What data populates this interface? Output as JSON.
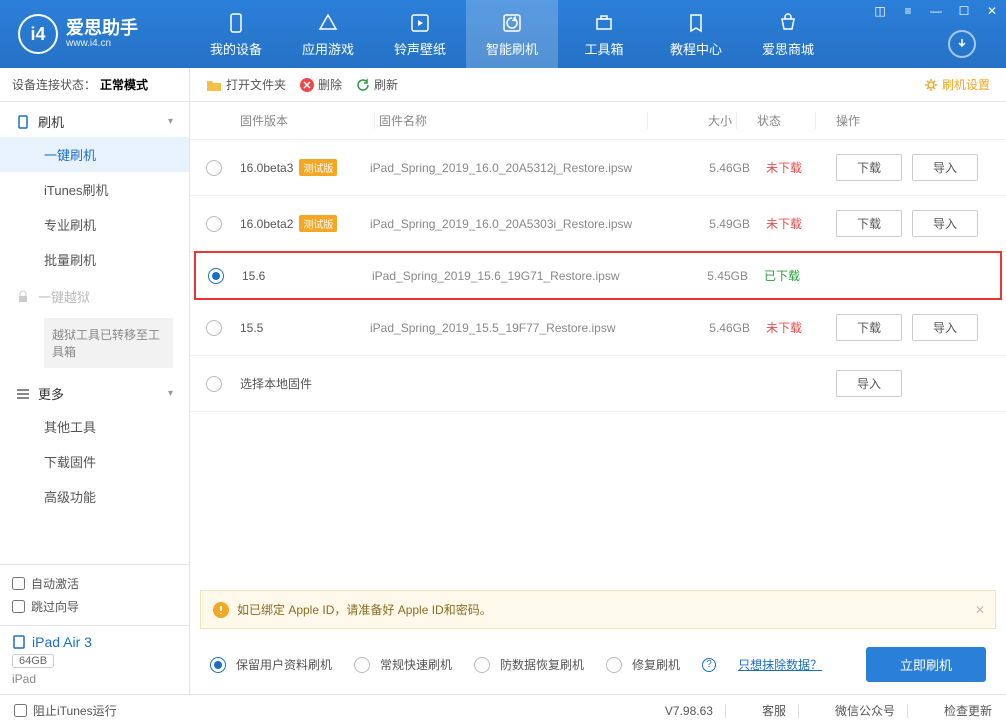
{
  "logo": {
    "title": "爱思助手",
    "sub": "www.i4.cn"
  },
  "nav": [
    "我的设备",
    "应用游戏",
    "铃声壁纸",
    "智能刷机",
    "工具箱",
    "教程中心",
    "爱思商城"
  ],
  "activeNav": 3,
  "status": {
    "label": "设备连接状态：",
    "value": "正常模式"
  },
  "side": {
    "group1": "刷机",
    "items1": [
      "一键刷机",
      "iTunes刷机",
      "专业刷机",
      "批量刷机"
    ],
    "jailbreak": "一键越狱",
    "jbNotice": "越狱工具已转移至工具箱",
    "group2": "更多",
    "items2": [
      "其他工具",
      "下载固件",
      "高级功能"
    ]
  },
  "sideBottom": {
    "autoActivate": "自动激活",
    "skipWizard": "跳过向导"
  },
  "device": {
    "name": "iPad Air 3",
    "capacity": "64GB",
    "type": "iPad"
  },
  "toolbar": {
    "open": "打开文件夹",
    "delete": "删除",
    "refresh": "刷新",
    "settings": "刷机设置"
  },
  "cols": {
    "ver": "固件版本",
    "name": "固件名称",
    "size": "大小",
    "status": "状态",
    "ops": "操作"
  },
  "btns": {
    "download": "下载",
    "import": "导入"
  },
  "statuses": {
    "nd": "未下载",
    "dl": "已下载"
  },
  "badge": "测试版",
  "firmware": [
    {
      "ver": "16.0beta3",
      "beta": true,
      "name": "iPad_Spring_2019_16.0_20A5312j_Restore.ipsw",
      "size": "5.46GB",
      "downloaded": false,
      "selected": false,
      "showOps": true
    },
    {
      "ver": "16.0beta2",
      "beta": true,
      "name": "iPad_Spring_2019_16.0_20A5303i_Restore.ipsw",
      "size": "5.49GB",
      "downloaded": false,
      "selected": false,
      "showOps": true
    },
    {
      "ver": "15.6",
      "beta": false,
      "name": "iPad_Spring_2019_15.6_19G71_Restore.ipsw",
      "size": "5.45GB",
      "downloaded": true,
      "selected": true,
      "showOps": false,
      "highlight": true
    },
    {
      "ver": "15.5",
      "beta": false,
      "name": "iPad_Spring_2019_15.5_19F77_Restore.ipsw",
      "size": "5.46GB",
      "downloaded": false,
      "selected": false,
      "showOps": true
    }
  ],
  "localRow": "选择本地固件",
  "alert": "如已绑定 Apple ID，请准备好 Apple ID和密码。",
  "options": [
    "保留用户资料刷机",
    "常规快速刷机",
    "防数据恢复刷机",
    "修复刷机"
  ],
  "eraseLink": "只想抹除数据？",
  "flashBtn": "立即刷机",
  "footer": {
    "blockItunes": "阻止iTunes运行",
    "version": "V7.98.63",
    "support": "客服",
    "wechat": "微信公众号",
    "update": "检查更新"
  }
}
